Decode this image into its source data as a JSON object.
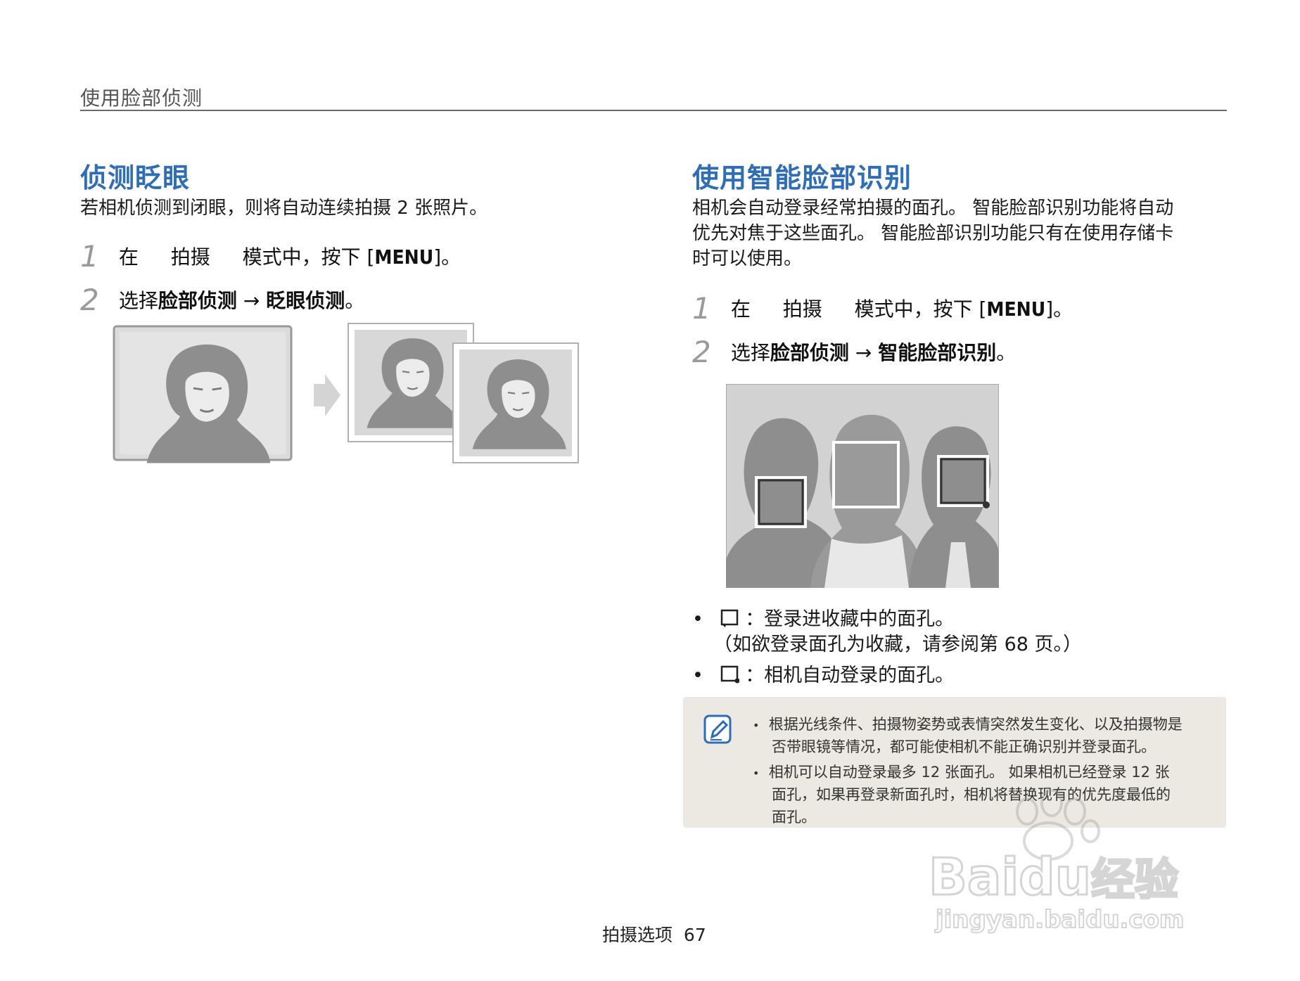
{
  "header": {
    "title": "使用脸部侦测"
  },
  "left": {
    "title": "侦测眨眼",
    "intro": "若相机侦测到闭眼，则将自动连续拍摄 2 张照片。",
    "steps": [
      {
        "num": "1",
        "pre": "在",
        "mode": "拍摄",
        "mid": "模式中，按下 [",
        "key": "MENU",
        "post": "]。"
      },
      {
        "num": "2",
        "pre": "选择",
        "bold1": "脸部侦测",
        "arrow": " → ",
        "bold2": "眨眼侦测",
        "post": "。"
      }
    ]
  },
  "right": {
    "title": "使用智能脸部识别",
    "intro_lines": [
      "相机会自动登录经常拍摄的面孔。 智能脸部识别功能将自动",
      "优先对焦于这些面孔。 智能脸部识别功能只有在使用存储卡",
      "时可以使用。"
    ],
    "steps": [
      {
        "num": "1",
        "pre": "在",
        "mode": "拍摄",
        "mid": "模式中，按下 [",
        "key": "MENU",
        "post": "]。"
      },
      {
        "num": "2",
        "pre": "选择",
        "bold1": "脸部侦测",
        "arrow": " → ",
        "bold2": "智能脸部识别",
        "post": "。"
      }
    ],
    "bullets": [
      {
        "icon": "favorite-face-frame-icon",
        "text": "：登录进收藏中的面孔。",
        "sub": "（如欲登录面孔为收藏，请参阅第 68 页。）"
      },
      {
        "icon": "auto-face-frame-icon",
        "text": "：相机自动登录的面孔。"
      }
    ],
    "note": {
      "icon": "note-pencil-icon",
      "lines": [
        "根据光线条件、拍摄物姿势或表情突然发生变化、以及拍摄物是",
        "否带眼镜等情况，都可能使相机不能正确识别并登录面孔。",
        "相机可以自动登录最多 12 张面孔。 如果相机已经登录 12 张",
        "面孔，如果再登录新面孔时，相机将替换现有的优先度最低的",
        "面孔。"
      ]
    }
  },
  "footer": {
    "label": "拍摄选项",
    "page": "67"
  },
  "watermark": {
    "brand_a": "Bai",
    "brand_b": "du",
    "brand_c": "经验",
    "url": "jingyan.baidu.com"
  },
  "colors": {
    "accent": "#2f6db4",
    "photo_gray": "#8e8e8e",
    "note_bg": "#ece8e2"
  }
}
